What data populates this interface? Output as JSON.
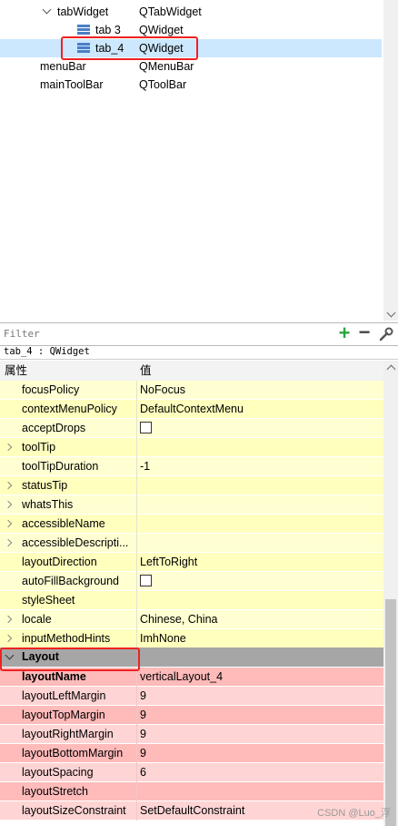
{
  "tree": {
    "rows": [
      {
        "name": "tabWidget",
        "cls": "QTabWidget"
      },
      {
        "name": "tab 3",
        "cls": "QWidget"
      },
      {
        "name": "tab_4",
        "cls": "QWidget"
      },
      {
        "name": "menuBar",
        "cls": "QMenuBar"
      },
      {
        "name": "mainToolBar",
        "cls": "QToolBar"
      }
    ]
  },
  "filter": {
    "placeholder": "Filter",
    "add_symbol": "+",
    "remove_symbol": "−"
  },
  "path": "tab_4 : QWidget",
  "props": {
    "header": {
      "name": "属性",
      "value": "值"
    },
    "rows": [
      {
        "name": "focusPolicy",
        "value": "NoFocus"
      },
      {
        "name": "contextMenuPolicy",
        "value": "DefaultContextMenu"
      },
      {
        "name": "acceptDrops",
        "value": ""
      },
      {
        "name": "toolTip",
        "value": ""
      },
      {
        "name": "toolTipDuration",
        "value": "-1"
      },
      {
        "name": "statusTip",
        "value": ""
      },
      {
        "name": "whatsThis",
        "value": ""
      },
      {
        "name": "accessibleName",
        "value": ""
      },
      {
        "name": "accessibleDescripti...",
        "value": ""
      },
      {
        "name": "layoutDirection",
        "value": "LeftToRight"
      },
      {
        "name": "autoFillBackground",
        "value": ""
      },
      {
        "name": "styleSheet",
        "value": ""
      },
      {
        "name": "locale",
        "value": "Chinese, China"
      },
      {
        "name": "inputMethodHints",
        "value": "ImhNone"
      }
    ],
    "layout_section": "Layout",
    "layout_rows": [
      {
        "name": "layoutName",
        "value": "verticalLayout_4"
      },
      {
        "name": "layoutLeftMargin",
        "value": "9"
      },
      {
        "name": "layoutTopMargin",
        "value": "9"
      },
      {
        "name": "layoutRightMargin",
        "value": "9"
      },
      {
        "name": "layoutBottomMargin",
        "value": "9"
      },
      {
        "name": "layoutSpacing",
        "value": "6"
      },
      {
        "name": "layoutStretch",
        "value": ""
      },
      {
        "name": "layoutSizeConstraint",
        "value": "SetDefaultConstraint"
      }
    ]
  },
  "watermark": "CSDN @Luo_浮",
  "colors": {
    "yellow_a": "#ffffd2",
    "yellow_b": "#ffffbe",
    "section_gray": "#a6a6a6",
    "pink_a": "#ffbaba",
    "pink_b": "#ffd4d4",
    "highlight_red": "#e22222",
    "selection_blue": "#cce8ff"
  }
}
